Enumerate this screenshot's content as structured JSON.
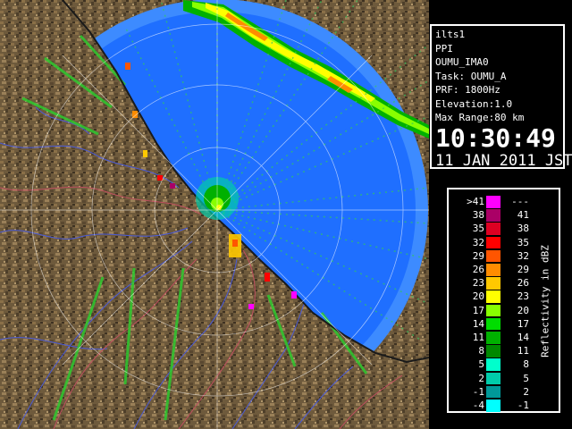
{
  "info": {
    "site": "ilts1",
    "scan": "PPI",
    "product": "OUMU_IMA0",
    "task": "Task: OUMU_A",
    "prf": "PRF: 1800Hz",
    "elevation": "Elevation:1.0",
    "max_range": "Max Range:80 km",
    "time": "10:30:49",
    "date": "11 JAN 2011 JST"
  },
  "legend": {
    "title": "Reflectivity in dBZ",
    "rows": [
      {
        "lo": ">41",
        "hi": "---",
        "color": "#ff00ff"
      },
      {
        "lo": "38",
        "hi": "41",
        "color": "#aa0066"
      },
      {
        "lo": "35",
        "hi": "38",
        "color": "#dd0022"
      },
      {
        "lo": "32",
        "hi": "35",
        "color": "#ff0000"
      },
      {
        "lo": "29",
        "hi": "32",
        "color": "#ff5500"
      },
      {
        "lo": "26",
        "hi": "29",
        "color": "#ff8c00"
      },
      {
        "lo": "23",
        "hi": "26",
        "color": "#ffc800"
      },
      {
        "lo": "20",
        "hi": "23",
        "color": "#ffff00"
      },
      {
        "lo": "17",
        "hi": "20",
        "color": "#88ff00"
      },
      {
        "lo": "14",
        "hi": "17",
        "color": "#00dd00"
      },
      {
        "lo": "11",
        "hi": "14",
        "color": "#00b000"
      },
      {
        "lo": "8",
        "hi": "11",
        "color": "#008800"
      },
      {
        "lo": "5",
        "hi": "8",
        "color": "#00ffcc"
      },
      {
        "lo": "2",
        "hi": "5",
        "color": "#00ccaa"
      },
      {
        "lo": "-1",
        "hi": "2",
        "color": "#009999"
      },
      {
        "lo": "-4",
        "hi": "-1",
        "color": "#00ffff"
      }
    ]
  },
  "map": {
    "sea_color": "#1f6fff",
    "outer_ring_color": "#3d8bff",
    "land_color": "#6e5a3c",
    "coast_color": "#1a1a1a",
    "river_color": "#4a5ad8",
    "boundary_color": "#c05060",
    "range_ring_color": "#ffffff"
  }
}
